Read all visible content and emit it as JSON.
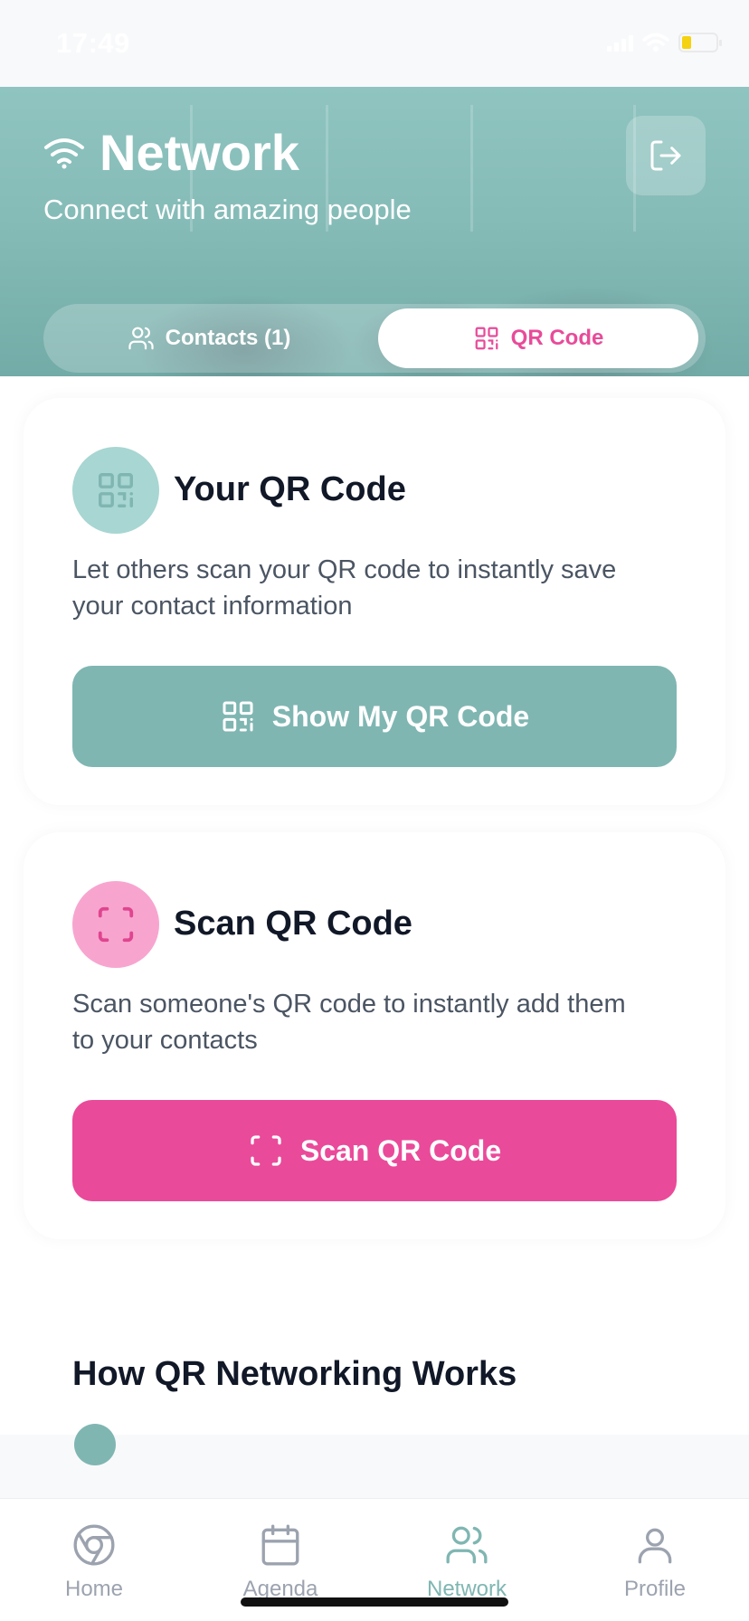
{
  "status_bar": {
    "time": "17:49"
  },
  "header": {
    "title": "Network",
    "subtitle": "Connect with amazing people",
    "tabs": [
      {
        "label": "Contacts (1)",
        "active": false
      },
      {
        "label": "QR Code",
        "active": true
      }
    ]
  },
  "cards": [
    {
      "title": "Your QR Code",
      "description": "Let others scan your QR code to instantly save your contact information",
      "button_label": "Show My QR Code",
      "icon": "qr-code-icon",
      "color": "#7fb6b2"
    },
    {
      "title": "Scan QR Code",
      "description": "Scan someone's QR code to instantly add them to your contacts",
      "button_label": "Scan QR Code",
      "icon": "scan-icon",
      "color": "#ea4a9a"
    }
  ],
  "section": {
    "title": "How QR Networking Works"
  },
  "bottom_nav": {
    "items": [
      {
        "label": "Home",
        "icon": "chrome-icon",
        "active": false
      },
      {
        "label": "Agenda",
        "icon": "calendar-icon",
        "active": false
      },
      {
        "label": "Network",
        "icon": "users-icon",
        "active": true
      },
      {
        "label": "Profile",
        "icon": "user-icon",
        "active": false
      }
    ]
  },
  "colors": {
    "accent_teal": "#7fb6b2",
    "accent_pink": "#ea4a9a"
  }
}
